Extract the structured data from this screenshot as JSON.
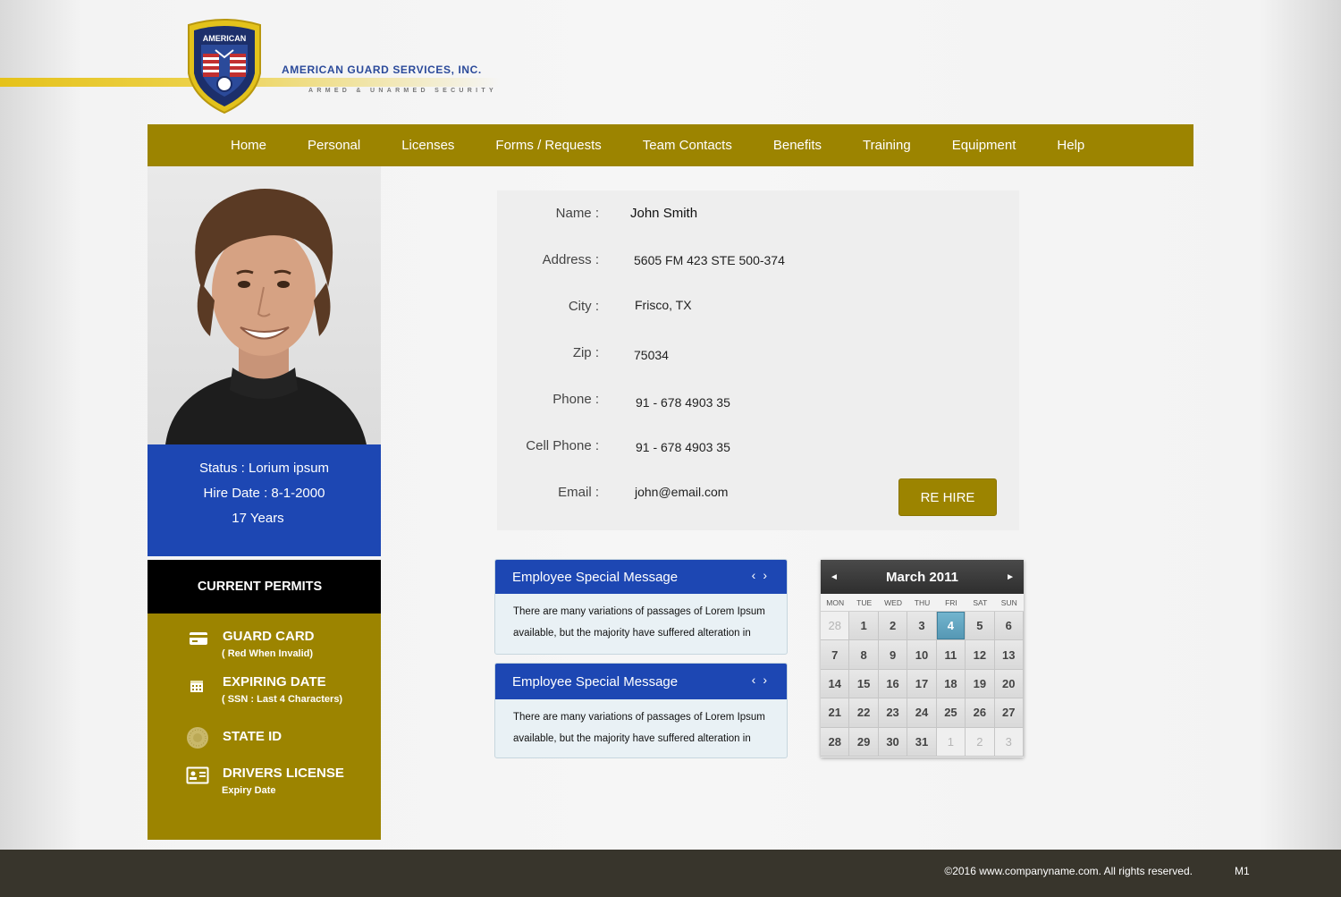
{
  "brand": {
    "logo_text": "AMERICAN",
    "name": "AMERICAN GUARD SERVICES, INC.",
    "tagline": "ARMED & UNARMED SECURITY",
    "accent_gold": "#9c8400",
    "accent_blue": "#1d47b3"
  },
  "nav": {
    "items": [
      {
        "label": "Home"
      },
      {
        "label": "Personal"
      },
      {
        "label": "Licenses"
      },
      {
        "label": "Forms / Requests"
      },
      {
        "label": "Team Contacts"
      },
      {
        "label": "Benefits"
      },
      {
        "label": "Training"
      },
      {
        "label": "Equipment"
      },
      {
        "label": "Help"
      }
    ]
  },
  "profile": {
    "status": "Status : Lorium ipsum",
    "hire_date": "Hire Date : 8-1-2000",
    "tenure": "17 Years"
  },
  "permits": {
    "header": "CURRENT PERMITS",
    "items": [
      {
        "icon": "credit-card-icon",
        "title": "GUARD CARD",
        "subtitle": "( Red When Invalid)"
      },
      {
        "icon": "calendar-icon",
        "title": "EXPIRING DATE",
        "subtitle": "( SSN  :  Last 4 Characters)"
      },
      {
        "icon": "seal-icon",
        "title": "STATE ID",
        "subtitle": ""
      },
      {
        "icon": "id-card-icon",
        "title": "DRIVERS LICENSE",
        "subtitle": "Expiry Date"
      }
    ]
  },
  "info": {
    "name_label": "Name :",
    "name_value": "John Smith",
    "address_label": "Address :",
    "address_value": "5605 FM 423 STE 500-374",
    "city_label": "City :",
    "city_value": "Frisco, TX",
    "zip_label": "Zip :",
    "zip_value": "75034",
    "phone_label": "Phone :",
    "phone_value": "91 - 678 4903 35",
    "cell_label": "Cell Phone :",
    "cell_value": "91 - 678 4903 35",
    "email_label": "Email :",
    "email_value": "john@email.com",
    "rehire_label": "RE HIRE"
  },
  "messages": [
    {
      "title": "Employee Special Message",
      "line1": "There are many variations of passages of Lorem Ipsum",
      "line2": "available, but the majority have suffered alteration in"
    },
    {
      "title": "Employee Special Message",
      "line1": "There are many variations of passages of Lorem Ipsum",
      "line2": "available, but the majority have suffered alteration in"
    }
  ],
  "calendar": {
    "title": "March 2011",
    "prev": "◄",
    "next": "►",
    "dow": [
      "MON",
      "TUE",
      "WED",
      "THU",
      "FRI",
      "SAT",
      "SUN"
    ],
    "days": [
      {
        "d": "28",
        "muted": true
      },
      {
        "d": "1"
      },
      {
        "d": "2"
      },
      {
        "d": "3"
      },
      {
        "d": "4",
        "selected": true
      },
      {
        "d": "5"
      },
      {
        "d": "6"
      },
      {
        "d": "7"
      },
      {
        "d": "8"
      },
      {
        "d": "9"
      },
      {
        "d": "10"
      },
      {
        "d": "11"
      },
      {
        "d": "12"
      },
      {
        "d": "13"
      },
      {
        "d": "14"
      },
      {
        "d": "15"
      },
      {
        "d": "16"
      },
      {
        "d": "17"
      },
      {
        "d": "18"
      },
      {
        "d": "19"
      },
      {
        "d": "20"
      },
      {
        "d": "21"
      },
      {
        "d": "22"
      },
      {
        "d": "23"
      },
      {
        "d": "24"
      },
      {
        "d": "25"
      },
      {
        "d": "26"
      },
      {
        "d": "27"
      },
      {
        "d": "28"
      },
      {
        "d": "29"
      },
      {
        "d": "30"
      },
      {
        "d": "31"
      },
      {
        "d": "1",
        "muted": true
      },
      {
        "d": "2",
        "muted": true
      },
      {
        "d": "3",
        "muted": true
      }
    ]
  },
  "footer": {
    "copyright": "©2016 www.companyname.com. All rights reserved.",
    "code": "M1"
  }
}
